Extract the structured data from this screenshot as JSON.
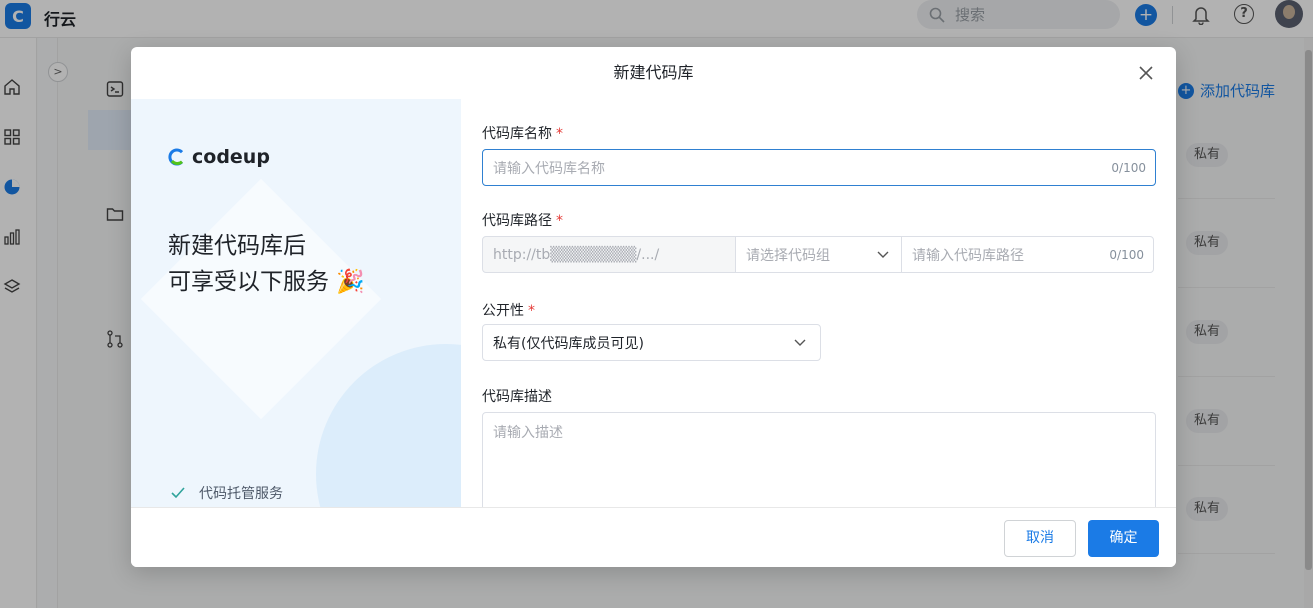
{
  "app": {
    "logo_letter": "C",
    "name": "行云"
  },
  "topbar": {
    "search_placeholder": "搜索",
    "plus_icon": "+",
    "help_icon": "?"
  },
  "background": {
    "collapse_icon": ">",
    "add_repo_label": "添加代码库",
    "add_repo_icon": "+",
    "rows": [
      {
        "badge": "私有"
      },
      {
        "badge": "私有"
      },
      {
        "badge": "私有"
      },
      {
        "badge": "私有"
      },
      {
        "badge": "私有"
      }
    ]
  },
  "modal": {
    "title": "新建代码库",
    "promo": {
      "logo_text": "codeup",
      "headline_line1": "新建代码库后",
      "headline_line2": "可享受以下服务 🎉",
      "features": [
        {
          "label": "代码托管服务"
        }
      ]
    },
    "form": {
      "name": {
        "label": "代码库名称",
        "required": "*",
        "placeholder": "请输入代码库名称",
        "counter": "0/100"
      },
      "path": {
        "label": "代码库路径",
        "required": "*",
        "prefix": "http://tb▒▒▒▒▒▒▒▒/.../",
        "group_placeholder": "请选择代码组",
        "path_placeholder": "请输入代码库路径",
        "counter": "0/100"
      },
      "visibility": {
        "label": "公开性",
        "required": "*",
        "value": "私有(仅代码库成员可见)"
      },
      "description": {
        "label": "代码库描述",
        "placeholder": "请输入描述"
      }
    },
    "footer": {
      "cancel_label": "取消",
      "confirm_label": "确定"
    }
  },
  "colors": {
    "primary": "#1b7be6",
    "required": "#e53935",
    "overlay": "rgba(0,0,0,0.30)"
  }
}
